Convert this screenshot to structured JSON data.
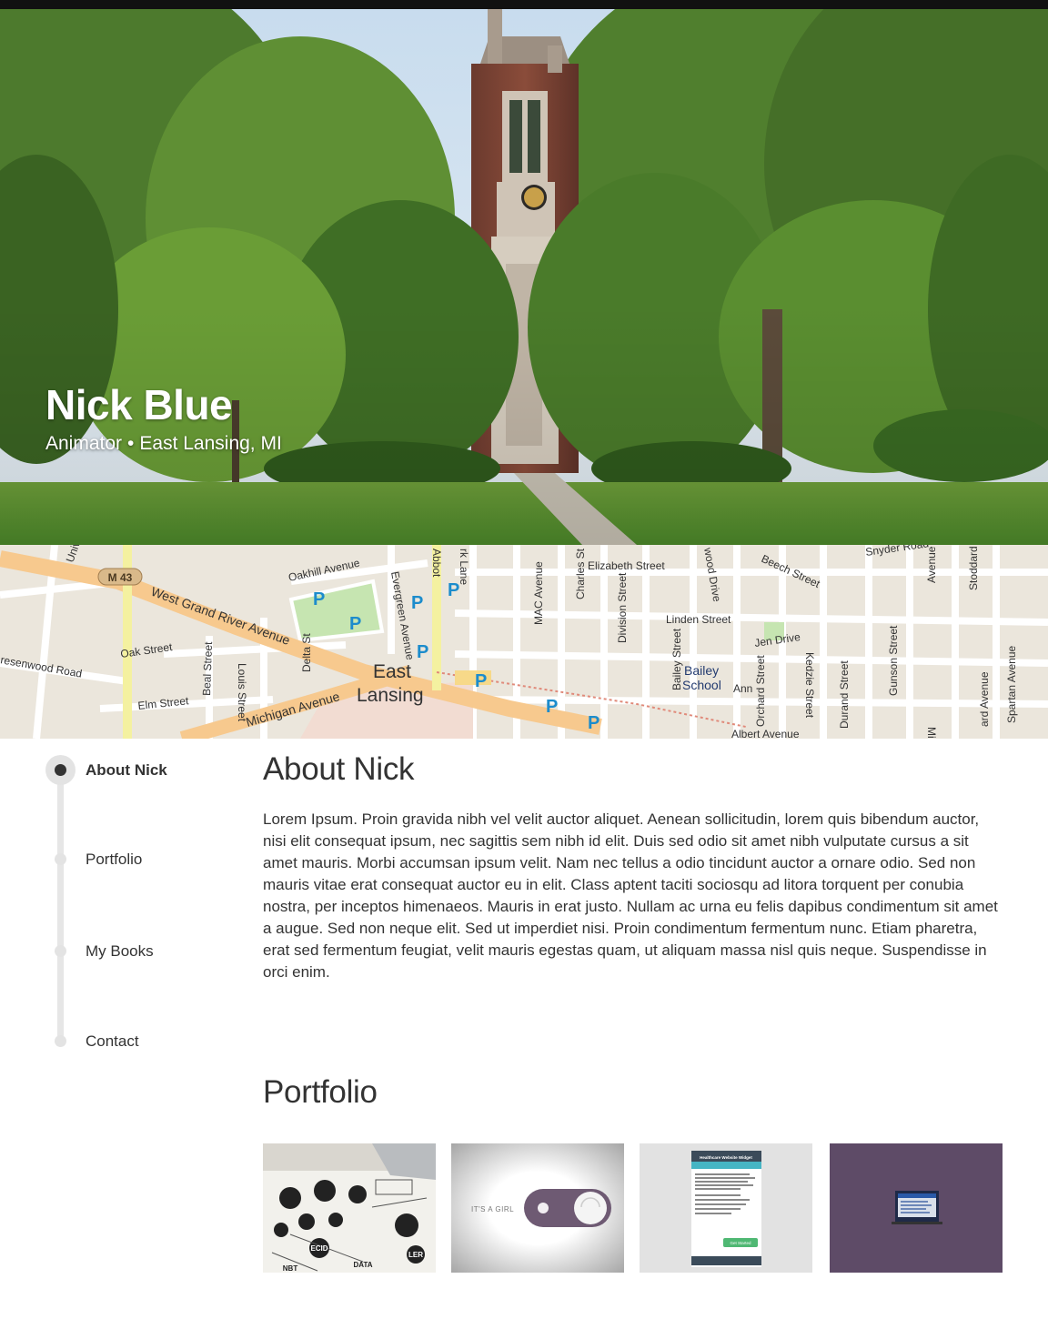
{
  "hero": {
    "name": "Nick Blue",
    "role": "Animator",
    "separator": "•",
    "location": "East Lansing, MI"
  },
  "map": {
    "route_badge": "M 43",
    "streets": [
      "University",
      "Oakhill Avenue",
      "West Grand River Avenue",
      "Evergreen Avenue",
      "Abbot",
      "rk Lane",
      "MAC Avenue",
      "Charles St",
      "Elizabeth Street",
      "Division Street",
      "wood Drive",
      "Beech Street",
      "Snyder Road",
      "Avenue",
      "Stoddard",
      "Linden Street",
      "Oak Street",
      "Delta St",
      "Louis Street",
      "Beal Street",
      "resenwood Road",
      "Elm Street",
      "Michigan Avenue",
      "Bailey Street",
      "Orchard Street",
      "Ann",
      "Jen Drive",
      "Kedzie Street",
      "Durand Street",
      "Gunson Street",
      "Spartan Avenue",
      "ard Avenue",
      "Albert Avenue",
      "Milford"
    ],
    "place_name_1": "East",
    "place_name_2": "Lansing",
    "school_name_1": "Bailey",
    "school_name_2": "School",
    "parking_symbol": "P"
  },
  "nav": {
    "items": [
      {
        "label": "About Nick",
        "active": true
      },
      {
        "label": "Portfolio",
        "active": false
      },
      {
        "label": "My Books",
        "active": false
      },
      {
        "label": "Contact",
        "active": false
      }
    ]
  },
  "about": {
    "title": "About Nick",
    "body": "Lorem Ipsum. Proin gravida nibh vel velit auctor aliquet. Aenean sollicitudin, lorem quis bibendum auctor, nisi elit consequat ipsum, nec sagittis sem nibh id elit. Duis sed odio sit amet nibh vulputate cursus a sit amet mauris. Morbi accumsan ipsum velit. Nam nec tellus a odio tincidunt auctor a ornare odio. Sed non  mauris vitae erat consequat auctor eu in elit. Class aptent taciti sociosqu ad litora torquent per conubia nostra, per inceptos himenaeos. Mauris in erat justo. Nullam ac urna eu felis dapibus condimentum sit amet a augue. Sed non neque elit. Sed ut imperdiet nisi. Proin condimentum fermentum nunc. Etiam pharetra, erat sed fermentum feugiat, velit mauris egestas quam, ut aliquam massa nisl quis neque. Suspendisse in orci enim."
  },
  "portfolio": {
    "title": "Portfolio",
    "items": [
      {
        "kind": "sketch",
        "labels": [
          "ECID",
          "DATA",
          "NBT",
          "LER"
        ]
      },
      {
        "kind": "toggle",
        "caption": "IT'S A GIRL"
      },
      {
        "kind": "widget",
        "title": "Healthcare Website Widget",
        "button": "Get Started"
      },
      {
        "kind": "screen"
      }
    ]
  },
  "colors": {
    "text": "#333333",
    "nav_track": "#e6e6e6",
    "map_base": "#ebe6dc",
    "map_major_road": "#f7c98e",
    "map_secondary_road": "#f4f1a0",
    "parking_blue": "#1c8ccc",
    "thumb_toggle_purple": "#6e5a73",
    "thumb_screen_purple": "#5e4b67",
    "widget_teal": "#46b5c4",
    "widget_green": "#4fb873"
  }
}
